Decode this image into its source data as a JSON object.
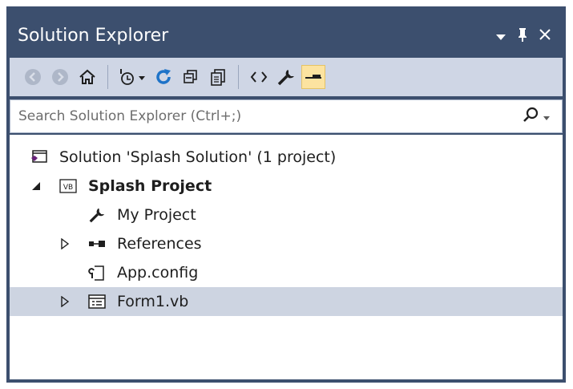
{
  "window": {
    "title": "Solution Explorer"
  },
  "search": {
    "placeholder": "Search Solution Explorer (Ctrl+;)"
  },
  "toolbar": {
    "buttons": [
      "back-icon",
      "forward-icon",
      "home-icon",
      "pending-changes-filter-icon",
      "sync-icon",
      "collapse-all-icon",
      "show-all-files-icon",
      "view-code-icon",
      "properties-icon",
      "preview-selected-items-icon"
    ],
    "active_button": "preview-selected-items-icon"
  },
  "tree": {
    "solution": "Solution 'Splash Solution' (1 project)",
    "project": "Splash Project",
    "items": [
      "My Project",
      "References",
      "App.config",
      "Form1.vb"
    ],
    "selected_item": "Form1.vb"
  },
  "colors": {
    "title_bg": "#3c4f6e",
    "toolbar_bg": "#cfd6e5",
    "selection_bg": "#cdd4e1",
    "active_toggle": "#fce3a0",
    "sync_blue": "#1e73c8",
    "vs_purple": "#68217a"
  }
}
